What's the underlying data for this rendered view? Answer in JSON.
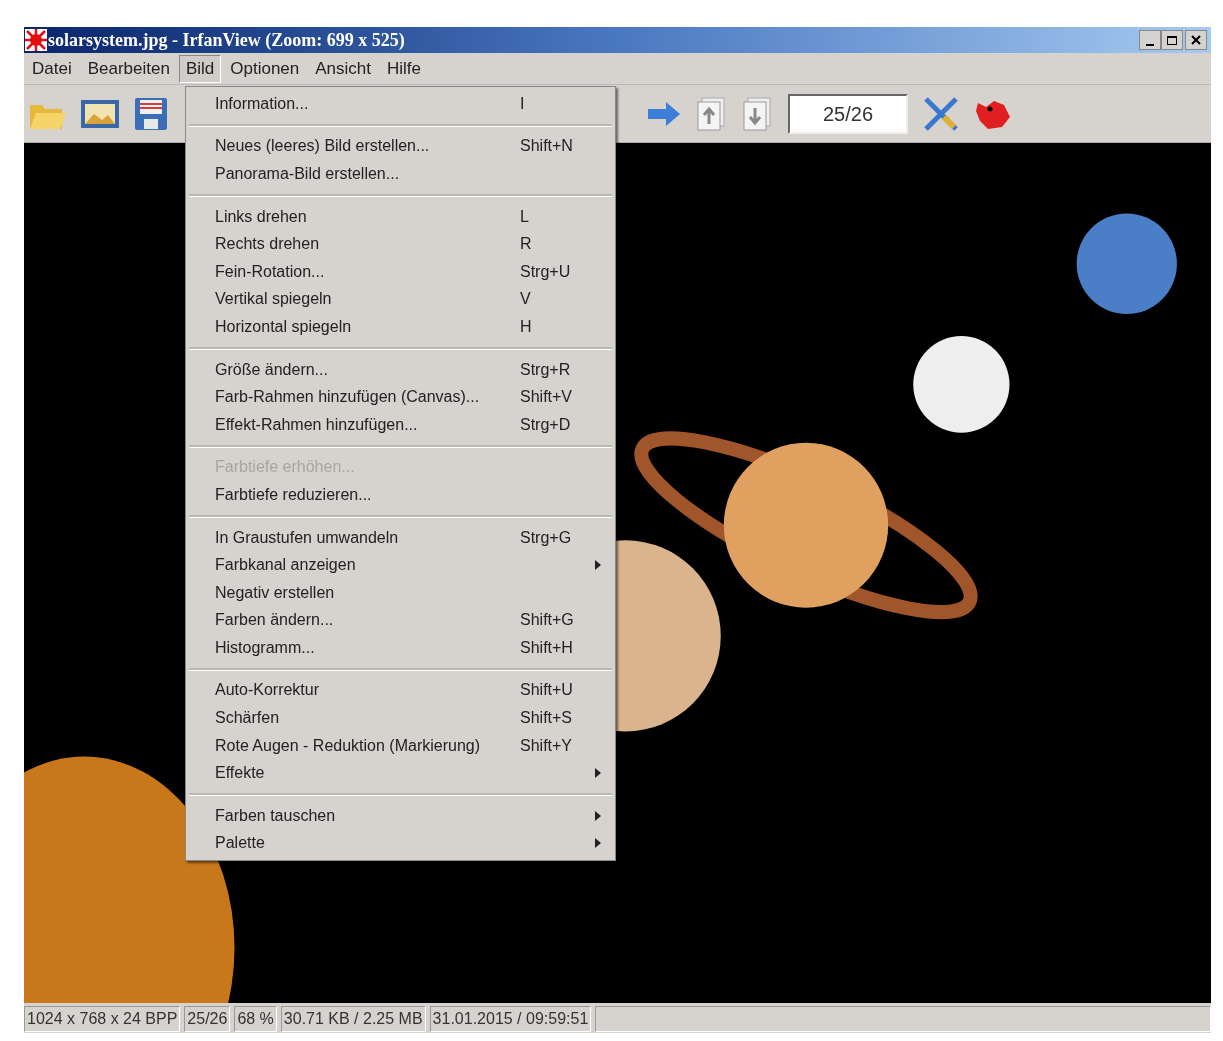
{
  "window": {
    "title": "solarsystem.jpg - IrfanView (Zoom: 699 x 525)"
  },
  "menubar": [
    {
      "label": "Datei",
      "selected": false
    },
    {
      "label": "Bearbeiten",
      "selected": false
    },
    {
      "label": "Bild",
      "selected": true
    },
    {
      "label": "Optionen",
      "selected": false
    },
    {
      "label": "Ansicht",
      "selected": false
    },
    {
      "label": "Hilfe",
      "selected": false
    }
  ],
  "toolbar": {
    "counter": "25/26"
  },
  "menu": {
    "groups": [
      [
        {
          "label": "Information...",
          "shortcut": "I",
          "submenu": false,
          "disabled": false
        }
      ],
      [
        {
          "label": "Neues (leeres) Bild erstellen...",
          "shortcut": "Shift+N",
          "submenu": false,
          "disabled": false
        },
        {
          "label": "Panorama-Bild erstellen...",
          "submenu": false,
          "disabled": false
        }
      ],
      [
        {
          "label": "Links drehen",
          "shortcut": "L",
          "submenu": false,
          "disabled": false
        },
        {
          "label": "Rechts drehen",
          "shortcut": "R",
          "submenu": false,
          "disabled": false
        },
        {
          "label": "Fein-Rotation...",
          "shortcut": "Strg+U",
          "submenu": false,
          "disabled": false
        },
        {
          "label": "Vertikal spiegeln",
          "shortcut": "V",
          "submenu": false,
          "disabled": false
        },
        {
          "label": "Horizontal spiegeln",
          "shortcut": "H",
          "submenu": false,
          "disabled": false
        }
      ],
      [
        {
          "label": "Größe ändern...",
          "shortcut": "Strg+R",
          "submenu": false,
          "disabled": false
        },
        {
          "label": "Farb-Rahmen hinzufügen (Canvas)...",
          "shortcut": "Shift+V",
          "submenu": false,
          "disabled": false
        },
        {
          "label": "Effekt-Rahmen hinzufügen...",
          "shortcut": "Strg+D",
          "submenu": false,
          "disabled": false
        }
      ],
      [
        {
          "label": "Farbtiefe erhöhen...",
          "submenu": false,
          "disabled": true
        },
        {
          "label": "Farbtiefe reduzieren...",
          "submenu": false,
          "disabled": false
        }
      ],
      [
        {
          "label": "In Graustufen umwandeln",
          "shortcut": "Strg+G",
          "submenu": false,
          "disabled": false
        },
        {
          "label": "Farbkanal anzeigen",
          "submenu": true,
          "disabled": false
        },
        {
          "label": "Negativ erstellen",
          "submenu": false,
          "disabled": false
        },
        {
          "label": "Farben ändern...",
          "shortcut": "Shift+G",
          "submenu": false,
          "disabled": false
        },
        {
          "label": "Histogramm...",
          "shortcut": "Shift+H",
          "submenu": false,
          "disabled": false
        }
      ],
      [
        {
          "label": "Auto-Korrektur",
          "shortcut": "Shift+U",
          "submenu": false,
          "disabled": false
        },
        {
          "label": "Schärfen",
          "shortcut": "Shift+S",
          "submenu": false,
          "disabled": false
        },
        {
          "label": "Rote Augen - Reduktion (Markierung)",
          "shortcut": "Shift+Y",
          "submenu": false,
          "disabled": false
        },
        {
          "label": "Effekte",
          "submenu": true,
          "disabled": false
        }
      ],
      [
        {
          "label": "Farben tauschen",
          "submenu": true,
          "disabled": false
        },
        {
          "label": "Palette",
          "submenu": true,
          "disabled": false
        }
      ]
    ]
  },
  "status_bar": [
    "1024 x 768 x 24 BPP",
    "25/26",
    "68 %",
    "30.71 KB / 2.25 MB",
    "31.01.2015 / 09:59:51"
  ]
}
